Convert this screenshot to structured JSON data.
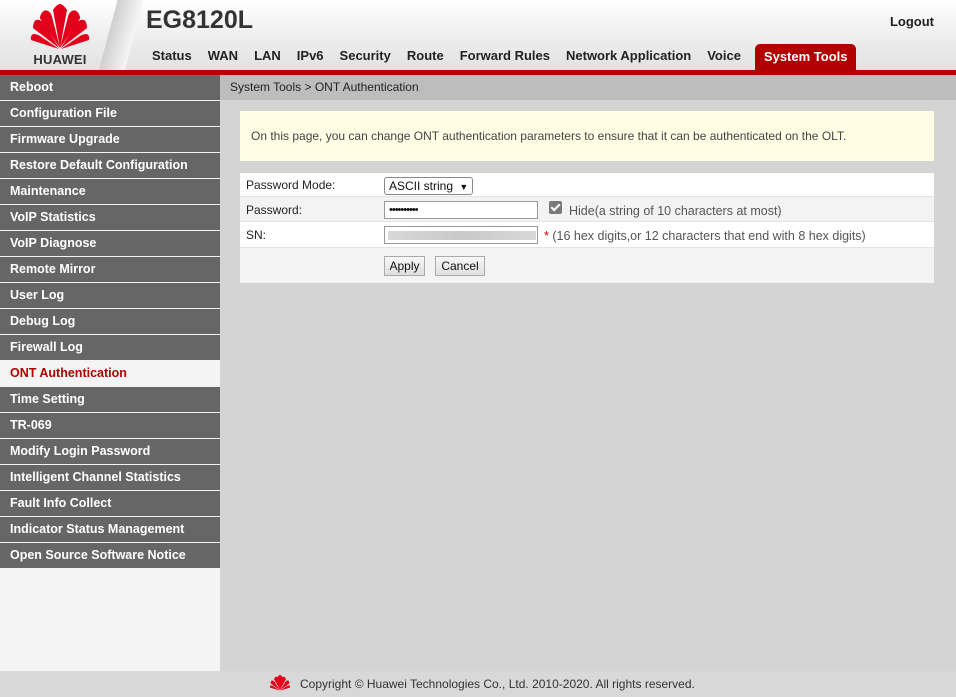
{
  "header": {
    "brand": "HUAWEI",
    "model": "EG8120L",
    "logout": "Logout"
  },
  "nav": {
    "tabs": [
      "Status",
      "WAN",
      "LAN",
      "IPv6",
      "Security",
      "Route",
      "Forward Rules",
      "Network Application",
      "Voice",
      "System Tools"
    ],
    "active": "System Tools"
  },
  "sidebar": {
    "items": [
      "Reboot",
      "Configuration File",
      "Firmware Upgrade",
      "Restore Default Configuration",
      "Maintenance",
      "VoIP Statistics",
      "VoIP Diagnose",
      "Remote Mirror",
      "User Log",
      "Debug Log",
      "Firewall Log",
      "ONT Authentication",
      "Time Setting",
      "TR-069",
      "Modify Login Password",
      "Intelligent Channel Statistics",
      "Fault Info Collect",
      "Indicator Status Management",
      "Open Source Software Notice"
    ],
    "active": "ONT Authentication"
  },
  "main": {
    "breadcrumb": "System Tools > ONT Authentication",
    "info": "On this page, you can change ONT authentication parameters to ensure that it can be authenticated on the OLT.",
    "form": {
      "password_mode_label": "Password Mode:",
      "password_mode_value": "ASCII string",
      "password_label": "Password:",
      "password_value": "••••••••••",
      "hide_label": "Hide(a string of 10 characters at most)",
      "hide_checked": true,
      "sn_label": "SN:",
      "sn_required": "*",
      "sn_hint": "(16 hex digits,or 12 characters that end with 8 hex digits)",
      "apply": "Apply",
      "cancel": "Cancel"
    }
  },
  "footer": {
    "copyright": "Copyright © Huawei Technologies Co., Ltd. 2010-2020. All rights reserved."
  },
  "colors": {
    "brand_red": "#b20000",
    "menu_bg": "#666666",
    "info_bg": "#fffde3"
  }
}
